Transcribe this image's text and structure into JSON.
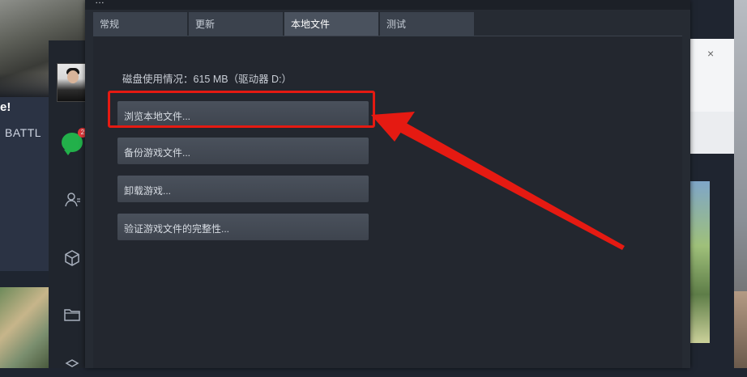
{
  "background_app": {
    "promo_text": "e!",
    "battle_text": "BATTL",
    "chat_badge": "2",
    "right_close": "×"
  },
  "dialog": {
    "title": "…",
    "tabs": [
      {
        "label": "常规",
        "active": false
      },
      {
        "label": "更新",
        "active": false
      },
      {
        "label": "本地文件",
        "active": true
      },
      {
        "label": "测试",
        "active": false
      }
    ],
    "disk_usage": "磁盘使用情况：615 MB（驱动器 D:）",
    "buttons": [
      {
        "label": "浏览本地文件..."
      },
      {
        "label": "备份游戏文件..."
      },
      {
        "label": "卸载游戏..."
      },
      {
        "label": "验证游戏文件的完整性..."
      }
    ]
  },
  "annotation": {
    "color": "#e51a12",
    "highlighted_button": "浏览本地文件..."
  },
  "colors": {
    "dialog_bg": "#262b33",
    "content_bg": "#23272f",
    "tab_active": "#4a525e",
    "tab_inactive": "#3b424d",
    "button_bg": "#444b56",
    "accent_red": "#e51a12"
  }
}
